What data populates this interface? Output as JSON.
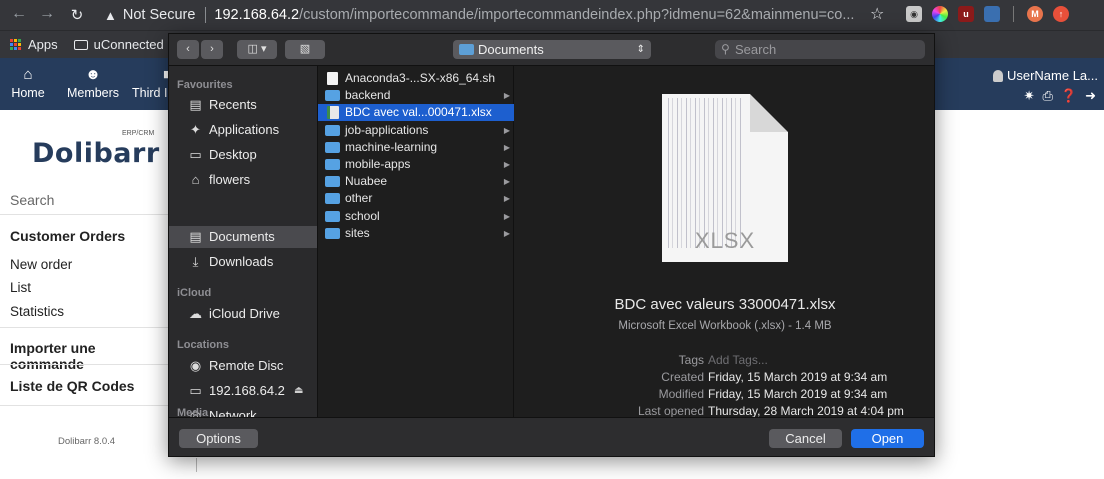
{
  "browser": {
    "not_secure": "Not Secure",
    "url_host": "192.168.64.2",
    "url_path": "/custom/importecommande/importecommandeindex.php?idmenu=62&mainmenu=co...",
    "avatar_letter": "M",
    "bookmarks": [
      {
        "label": "Apps",
        "icon": "apps-icon"
      },
      {
        "label": "uConnected",
        "icon": "folder-icon"
      }
    ]
  },
  "topnav": {
    "items": [
      {
        "label": "Home",
        "icon": "home-icon"
      },
      {
        "label": "Members",
        "icon": "members-icon"
      },
      {
        "label": "Third I",
        "icon": "thirdparty-icon"
      }
    ],
    "user": "UserName La..."
  },
  "leftmenu": {
    "logo": "Dolibarr",
    "logo_sup": "ERP/CRM",
    "search": "Search",
    "section_title": "Customer Orders",
    "items": [
      "New order",
      "List",
      "Statistics"
    ],
    "import": "Importer une commande",
    "qr": "Liste de QR Codes",
    "version": "Dolibarr 8.0.4"
  },
  "dialog": {
    "location": "Documents",
    "search_placeholder": "Search",
    "sidebar": {
      "favourites_title": "Favourites",
      "favourites": [
        {
          "label": "Recents",
          "icon": "recents-icon",
          "selected": false
        },
        {
          "label": "Applications",
          "icon": "applications-icon",
          "selected": false
        },
        {
          "label": "Desktop",
          "icon": "desktop-icon",
          "selected": false
        },
        {
          "label": "flowers",
          "icon": "home-icon",
          "selected": false
        },
        {
          "label": "Documents",
          "icon": "documents-icon",
          "selected": true
        },
        {
          "label": "Downloads",
          "icon": "downloads-icon",
          "selected": false
        }
      ],
      "icloud_title": "iCloud",
      "icloud": [
        {
          "label": "iCloud Drive",
          "icon": "cloud-icon"
        }
      ],
      "locations_title": "Locations",
      "locations": [
        {
          "label": "Remote Disc",
          "icon": "disc-icon"
        },
        {
          "label": "192.168.64.2",
          "icon": "computer-icon"
        },
        {
          "label": "Network",
          "icon": "network-icon"
        }
      ],
      "media_title": "Media"
    },
    "files": [
      {
        "name": "Anaconda3-...SX-x86_64.sh",
        "type": "file",
        "selected": false,
        "has_children": false
      },
      {
        "name": "backend",
        "type": "folder",
        "selected": false,
        "has_children": true
      },
      {
        "name": "BDC avec val...000471.xlsx",
        "type": "xls",
        "selected": true,
        "has_children": false
      },
      {
        "name": "job-applications",
        "type": "folder",
        "selected": false,
        "has_children": true
      },
      {
        "name": "machine-learning",
        "type": "folder",
        "selected": false,
        "has_children": true
      },
      {
        "name": "mobile-apps",
        "type": "folder",
        "selected": false,
        "has_children": true
      },
      {
        "name": "Nuabee",
        "type": "folder",
        "selected": false,
        "has_children": true
      },
      {
        "name": "other",
        "type": "folder",
        "selected": false,
        "has_children": true
      },
      {
        "name": "school",
        "type": "folder",
        "selected": false,
        "has_children": true
      },
      {
        "name": "sites",
        "type": "folder",
        "selected": false,
        "has_children": true
      }
    ],
    "preview": {
      "ext_label": "XLSX",
      "filename": "BDC avec valeurs 33000471.xlsx",
      "kind": "Microsoft Excel Workbook (.xlsx) - 1.4 MB",
      "meta": [
        {
          "key": "Tags",
          "value": "Add Tags...",
          "placeholder": true
        },
        {
          "key": "Created",
          "value": "Friday, 15 March 2019 at 9:34 am",
          "placeholder": false
        },
        {
          "key": "Modified",
          "value": "Friday, 15 March 2019 at 9:34 am",
          "placeholder": false
        },
        {
          "key": "Last opened",
          "value": "Thursday, 28 March 2019 at 4:04 pm",
          "placeholder": false
        }
      ]
    },
    "buttons": {
      "options": "Options",
      "cancel": "Cancel",
      "open": "Open"
    }
  },
  "colors": {
    "accent": "#1f6fe8",
    "selection": "#1d5fcf",
    "dolibarr_nav": "#263c5c"
  }
}
